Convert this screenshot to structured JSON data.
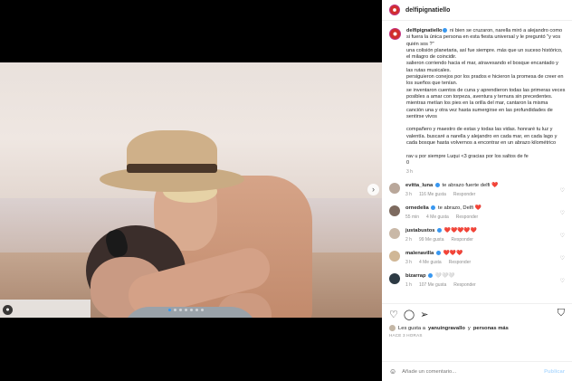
{
  "post": {
    "username": "delfipignatiello",
    "caption_lines": [
      "ni bien se cruzaron, narella miró a alejandro como si fuera la única persona en esta fiesta universal y le preguntó \"y vos quién sos ?\"",
      "una colisión planetaria, así fue siempre. más que un suceso histórico, el milagro de coincidir.",
      "salieron corriendo hacia el mar, atravesando el bosque encantado y las rutas musicales.",
      "persiguieron conejos por los prados e hicieron la promesa de creer en los sueños que tenían.",
      "se inventaron cuentos de cuna y aprendieron todas las primeras veces posibles a amar con torpeza, aventura y ternura sin precedentes.",
      "mientras metían los pies en la orilla del mar, cantaron la misma canción una y otra vez hasta sumergirse en las profundidades de sentirse vivos",
      "",
      "compañero y maestro de estas y todas las vidas. honraré tu luz y valentía. buscaré a narella y alejandro en cada mar, en cada lago y cada bosque hasta volvernos a encontrar en un abrazo kilométrico",
      "",
      "rav u por siempre Luqui <3 gracias por los saltos de fe",
      "0"
    ],
    "caption_time": "3 h"
  },
  "comments": [
    {
      "user": "evitta_luna",
      "verified": true,
      "text": "te abrazo fuerte delfi ❤️",
      "time": "3 h",
      "likes": "116 Me gusta",
      "reply": "Responder",
      "avatar_color": "#b9a79a"
    },
    {
      "user": "ornedelia",
      "verified": true,
      "text": "te abrazo, Delfi ❤️",
      "time": "55 min",
      "likes": "4 Me gusta",
      "reply": "Responder",
      "avatar_color": "#7d6a5f"
    },
    {
      "user": "justabustos",
      "verified": true,
      "text": "❤️❤️❤️❤️❤️",
      "time": "2 h",
      "likes": "99 Me gusta",
      "reply": "Responder",
      "avatar_color": "#c9b8a7"
    },
    {
      "user": "malenavilla",
      "verified": true,
      "text": "❤️❤️❤️",
      "time": "3 h",
      "likes": "4 Me gusta",
      "reply": "Responder",
      "avatar_color": "#d0b796"
    },
    {
      "user": "bizarrap",
      "verified": true,
      "text": "🤍🤍🤍",
      "time": "1 h",
      "likes": "107 Me gusta",
      "reply": "Responder",
      "avatar_color": "#2d3a44"
    }
  ],
  "likes_text": {
    "prefix": "Les gusta a",
    "user1": "yanuingravallo",
    "middle": "y",
    "others": "personas más"
  },
  "time_ago": "Hace 3 horas",
  "add_comment": {
    "placeholder": "Añade un comentario...",
    "publish": "Publicar"
  },
  "icons": {
    "like": "heart-icon",
    "comment": "comment-icon",
    "share": "send-icon",
    "save": "bookmark-icon",
    "emoji": "smiley-icon",
    "next": "chevron-right-icon"
  },
  "colors": {
    "accent": "#3897f0",
    "heart": "#ed4956"
  }
}
